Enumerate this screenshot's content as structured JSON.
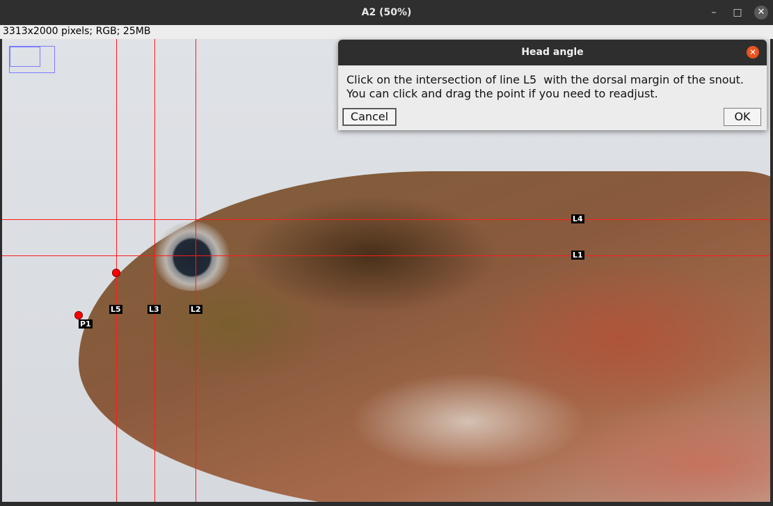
{
  "window": {
    "title": "A2 (50%)",
    "minimize_glyph": "–",
    "maximize_glyph": "□",
    "close_glyph": "✕"
  },
  "status": {
    "text": "3313x2000 pixels; RGB; 25MB"
  },
  "overlay": {
    "line_color": "#ff1a1a",
    "labels": {
      "L1": "L1",
      "L2": "L2",
      "L3": "L3",
      "L4": "L4",
      "L5": "L5",
      "P1": "P1"
    }
  },
  "dialog": {
    "title": "Head angle",
    "close_glyph": "✕",
    "message_line1": "Click on the intersection of line L5  with the dorsal margin of the snout.",
    "message_line2": "You can click and drag the point if you need to readjust.",
    "cancel_label": "Cancel",
    "ok_label": "OK",
    "close_color": "#e95420"
  }
}
